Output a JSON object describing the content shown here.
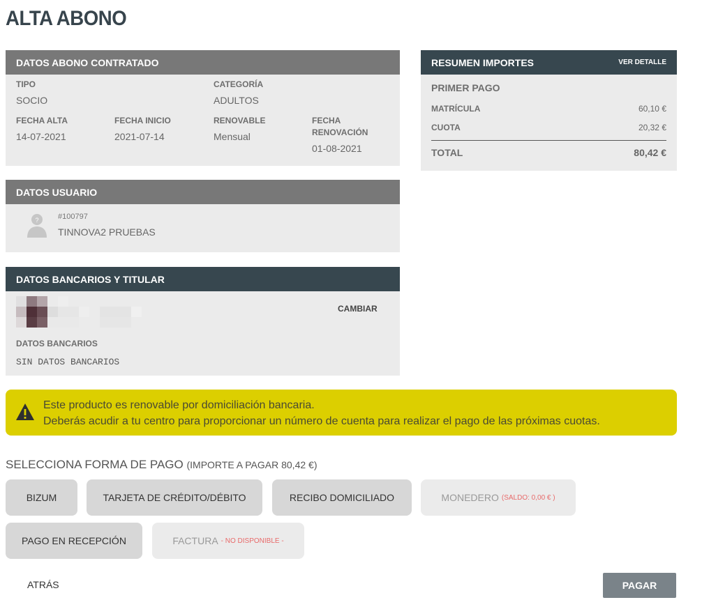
{
  "page": {
    "title": "ALTA ABONO"
  },
  "abono": {
    "header": "DATOS ABONO CONTRATADO",
    "tipo_label": "TIPO",
    "tipo_value": "SOCIO",
    "categoria_label": "CATEGORÍA",
    "categoria_value": "ADULTOS",
    "fecha_alta_label": "FECHA ALTA",
    "fecha_alta_value": "14-07-2021",
    "fecha_inicio_label": "FECHA INICIO",
    "fecha_inicio_value": "2021-07-14",
    "renovable_label": "RENOVABLE",
    "renovable_value": "Mensual",
    "fecha_renov_label_1": "FECHA",
    "fecha_renov_label_2": "RENOVACIÓN",
    "fecha_renov_value": "01-08-2021"
  },
  "usuario": {
    "header": "DATOS USUARIO",
    "id": "#100797",
    "name": "TINNOVA2 PRUEBAS",
    "avatar_icon": "user-avatar-icon"
  },
  "bank": {
    "header": "DATOS BANCARIOS Y TITULAR",
    "change_label": "CAMBIAR",
    "data_label": "DATOS BANCARIOS",
    "data_value": "SIN DATOS BANCARIOS"
  },
  "resumen": {
    "header": "RESUMEN IMPORTES",
    "detail_link": "VER DETALLE",
    "primer_pago": "PRIMER PAGO",
    "rows": [
      {
        "label": "MATRÍCULA",
        "amount": "60,10 €"
      },
      {
        "label": "CUOTA",
        "amount": "20,32 €"
      }
    ],
    "total_label": "TOTAL",
    "total_amount": "80,42 €"
  },
  "warning": {
    "icon": "warning-icon",
    "line1": "Este producto es renovable por domiciliación bancaria.",
    "line2": "Deberás acudir a tu centro para proporcionar un número de cuenta para realizar el pago de las próximas cuotas."
  },
  "payment": {
    "title": "SELECCIONA FORMA DE PAGO",
    "subtitle": "(IMPORTE A PAGAR 80,42 €)",
    "bizum": "BIZUM",
    "tarjeta": "TARJETA DE CRÉDITO/DÉBITO",
    "recibo": "RECIBO DOMICILIADO",
    "monedero": "MONEDERO",
    "monedero_note": "(SALDO: 0,00 € )",
    "recepcion": "PAGO EN RECEPCIÓN",
    "factura": "FACTURA",
    "factura_note": "- NO DISPONIBLE -"
  },
  "footer": {
    "back": "ATRÁS",
    "pay": "PAGAR"
  },
  "colors": {
    "dark_header": "#37474f",
    "grey_header": "#787878",
    "warning_bg": "#dccf00",
    "pay_button": "#7a8389"
  }
}
